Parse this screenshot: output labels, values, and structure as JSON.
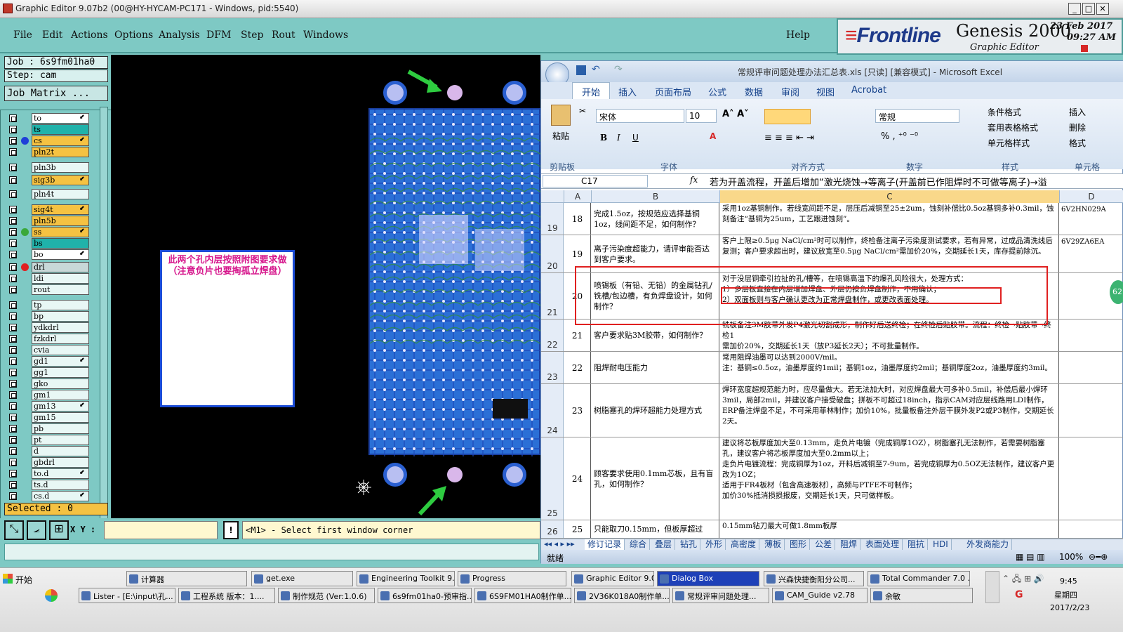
{
  "window": {
    "title": "Graphic Editor 9.07b2 (00@HY-HYCAM-PC171 - Windows, pid:5540)"
  },
  "menu": {
    "items": [
      "File",
      "Edit",
      "Actions",
      "Options",
      "Analysis",
      "DFM",
      "Step",
      "Rout",
      "Windows"
    ],
    "help": "Help"
  },
  "brand": {
    "logo": "Frontline",
    "product": "Genesis 2000",
    "subtitle": "Graphic Editor",
    "date": "23 Feb 2017",
    "time": "09:27 AM"
  },
  "job": {
    "job_label": "Job : 6s9fm01ha0",
    "step_label": "Step: cam",
    "matrix_button": "Job Matrix ...",
    "selected": "Selected : 0"
  },
  "layers": [
    {
      "name": "to",
      "bg": "#ffffff",
      "arrow": true,
      "dot": ""
    },
    {
      "name": "ts",
      "bg": "#20b2aa",
      "arrow": false,
      "dot": ""
    },
    {
      "name": "cs",
      "bg": "#f5c242",
      "arrow": true,
      "dot": "#1f3fd8"
    },
    {
      "name": "pln2t",
      "bg": "#f5c242",
      "arrow": false,
      "dot": ""
    },
    {
      "name": "pln3b",
      "bg": "#e8f7f5",
      "arrow": false,
      "dot": ""
    },
    {
      "name": "sig3b",
      "bg": "#f5c242",
      "arrow": true,
      "dot": ""
    },
    {
      "name": "pln4t",
      "bg": "#e8f7f5",
      "arrow": false,
      "dot": ""
    },
    {
      "name": "sig4t",
      "bg": "#f5c242",
      "arrow": true,
      "dot": ""
    },
    {
      "name": "pln5b",
      "bg": "#f5c242",
      "arrow": false,
      "dot": ""
    },
    {
      "name": "ss",
      "bg": "#f5c242",
      "arrow": true,
      "dot": "#3aa83a"
    },
    {
      "name": "bs",
      "bg": "#20b2aa",
      "arrow": false,
      "dot": ""
    },
    {
      "name": "bo",
      "bg": "#ffffff",
      "arrow": true,
      "dot": ""
    },
    {
      "name": "drl",
      "bg": "#c8d8d8",
      "arrow": false,
      "dot": "#e02020"
    },
    {
      "name": "ldi",
      "bg": "#e8f7f5",
      "arrow": false,
      "dot": ""
    },
    {
      "name": "rout",
      "bg": "#e8f7f5",
      "arrow": false,
      "dot": ""
    },
    {
      "name": "tp",
      "bg": "#e8f7f5",
      "arrow": false,
      "dot": ""
    },
    {
      "name": "bp",
      "bg": "#e8f7f5",
      "arrow": false,
      "dot": ""
    },
    {
      "name": "ydkdrl",
      "bg": "#e8f7f5",
      "arrow": false,
      "dot": ""
    },
    {
      "name": "fzkdrl",
      "bg": "#e8f7f5",
      "arrow": false,
      "dot": ""
    },
    {
      "name": "cvia",
      "bg": "#e8f7f5",
      "arrow": false,
      "dot": ""
    },
    {
      "name": "gd1",
      "bg": "#e8f7f5",
      "arrow": true,
      "dot": ""
    },
    {
      "name": "gg1",
      "bg": "#e8f7f5",
      "arrow": false,
      "dot": ""
    },
    {
      "name": "gko",
      "bg": "#e8f7f5",
      "arrow": false,
      "dot": ""
    },
    {
      "name": "gm1",
      "bg": "#e8f7f5",
      "arrow": false,
      "dot": ""
    },
    {
      "name": "gm13",
      "bg": "#e8f7f5",
      "arrow": true,
      "dot": ""
    },
    {
      "name": "gm15",
      "bg": "#e8f7f5",
      "arrow": false,
      "dot": ""
    },
    {
      "name": "pb",
      "bg": "#e8f7f5",
      "arrow": false,
      "dot": ""
    },
    {
      "name": "pt",
      "bg": "#e8f7f5",
      "arrow": false,
      "dot": ""
    },
    {
      "name": "d",
      "bg": "#e8f7f5",
      "arrow": false,
      "dot": ""
    },
    {
      "name": "gbdrl",
      "bg": "#e8f7f5",
      "arrow": false,
      "dot": ""
    },
    {
      "name": "to.d",
      "bg": "#e8f7f5",
      "arrow": true,
      "dot": ""
    },
    {
      "name": "ts.d",
      "bg": "#e8f7f5",
      "arrow": false,
      "dot": ""
    },
    {
      "name": "cs.d",
      "bg": "#e8f7f5",
      "arrow": true,
      "dot": ""
    }
  ],
  "note": {
    "text": "此两个孔内层按照附图要求做（注意负片也要掏孤立焊盘）"
  },
  "status": {
    "xy_label": "X Y :",
    "message": "<M1> - Select first window corner"
  },
  "excel": {
    "title": "常规评审问题处理办法汇总表.xls  [只读]  [兼容模式] - Microsoft Excel",
    "tabs": [
      "开始",
      "插入",
      "页面布局",
      "公式",
      "数据",
      "审阅",
      "视图",
      "Acrobat"
    ],
    "ribbon": {
      "paste": "粘贴",
      "font": "宋体",
      "size": "10",
      "number_format": "常规",
      "cond": "条件格式",
      "table": "套用表格格式",
      "cellstyle": "单元格样式",
      "insert": "插入",
      "delete": "删除",
      "format": "格式",
      "groups": [
        "剪贴板",
        "字体",
        "对齐方式",
        "数字",
        "样式",
        "单元格"
      ]
    },
    "namebox": "C17",
    "formula": "若为开盖流程，开盖后增加“激光烧蚀→等离子(开盖前已作阻焊时不可做等离子)→溢",
    "columns": [
      "A",
      "B",
      "C",
      "D"
    ],
    "rows": [
      {
        "rownum": "19",
        "a": "18",
        "b": "完成1.5oz，按规范应选择基铜1oz，线间距不足，如何制作？",
        "c": "采用1oz基铜制作。若线宽间距不足，层压后减铜至25±2um，蚀刻补偿比0.5oz基铜多补0.3mil，蚀刻备注“基铜为25um，工艺跟进蚀刻”。",
        "d": "6V2HN029A"
      },
      {
        "rownum": "20",
        "a": "19",
        "b": "离子污染度超能力，请评审能否达到客户要求。",
        "c": "客户上限≥0.5μg NaCl/cm²时可以制作，终检备注离子污染度测试要求，若有异常，过成品清洗线后复测；客户要求超出时，建议放宽至0.5μg NaCl/cm²需加价20%，交期延长1天，库存提前除沉。",
        "d": "6V29ZA6EA"
      },
      {
        "rownum": "21",
        "a": "20",
        "b": "喷锡板（有铅、无铅）的金属钻孔/铣槽/包边槽，有负焊盘设计，如何制作？",
        "c": "对于没层铜牵引拉扯的孔/槽等，在喷锡高温下的爆孔风险很大，处理方式：\n1）多层板直接在内层增加焊盘、外层仍按负焊盘制作，不用确认；\n2）双面板则与客户确认更改为正常焊盘制作，或更改表面处理。",
        "d": ""
      },
      {
        "rownum": "22",
        "a": "21",
        "b": "客户要求贴3M胶带，如何制作？",
        "c": "铣板备注3M胶带外发P4激光切割成形，制作好后送终检；在终检后贴胶带。流程：终检→贴胶带→终检1\n需加价20%，交期延长1天（放P3延长2天）；不可批量制作。",
        "d": ""
      },
      {
        "rownum": "23",
        "a": "22",
        "b": "阻焊耐电压能力",
        "c": "常用阻焊油墨可以达到2000V/mil。\n注：基铜≤0.5oz，油墨厚度约1mil；基铜1oz，油墨厚度约2mil；基铜厚度2oz，油墨厚度约3mil。",
        "d": ""
      },
      {
        "rownum": "24",
        "a": "23",
        "b": "树脂塞孔的焊环超能力处理方式",
        "c": "焊环宽度超规范能力时，应尽量做大。若无法加大时，对应焊盘最大可多补0.5mil，补偿后最小焊环3mil，局部2mil，并建议客户接受破盘；拼板不可超过18inch，指示CAM对应层线路用LDI制作，ERP备注焊盘不足，不可采用菲林制作；加价10%，批量板备注外层干膜外发P2或P3制作，交期延长2天。",
        "d": ""
      },
      {
        "rownum": "25",
        "a": "24",
        "b": "顾客要求使用0.1mm芯板，且有盲孔，如何制作？",
        "c": "建议将芯板厚度加大至0.13mm，走负片电镀（完成铜厚1OZ），树脂塞孔无法制作，若需要树脂塞孔，建议客户将芯板厚度加大至0.2mm以上；\n走负片电镀流程：完成铜厚为1oz，开料后减铜至7-9um，若完成铜厚为0.5OZ无法制作，建议客户更改为1OZ；\n适用于FR4板材（包含高速板材），高频与PTFE不可制作；\n加价30%抵消损损报废，交期延长1天，只可做样板。",
        "d": ""
      },
      {
        "rownum": "26",
        "a": "25",
        "b": "只能取刀0.15mm，但板厚超过",
        "c": "0.15mm钻刀最大可做1.8mm板厚",
        "d": ""
      }
    ],
    "sheet_tabs": [
      "修订记录",
      "综合",
      "叠层",
      "钻孔",
      "外形",
      "高密度",
      "薄板",
      "图形",
      "公差",
      "阻焊",
      "表面处理",
      "阻抗",
      "HDI",
      "外发商能力"
    ],
    "status_left": "就绪",
    "zoom": "100%"
  },
  "taskbar": {
    "start": "开始",
    "row1": [
      "计算器",
      "get.exe",
      "Engineering Toolkit 9....",
      "Progress",
      "Graphic Editor 9.07b2 ...",
      "Dialog Box",
      "兴森快捷衡阳分公司...",
      "Total Commander 7.0 ..."
    ],
    "row2": [
      "Lister - [E:\\input\\孔...",
      "工程系统  版本：1....",
      "制作规范 (Ver:1.0.6)",
      "6s9fm01ha0-预审指...",
      "6S9FM01HA0制作单...",
      "2V36K018A0制作单...",
      "常规评审问题处理...",
      "CAM_Guide v2.78",
      "余敏"
    ],
    "clock_time": "9:45",
    "clock_day": "星期四",
    "clock_date": "2017/2/23"
  }
}
